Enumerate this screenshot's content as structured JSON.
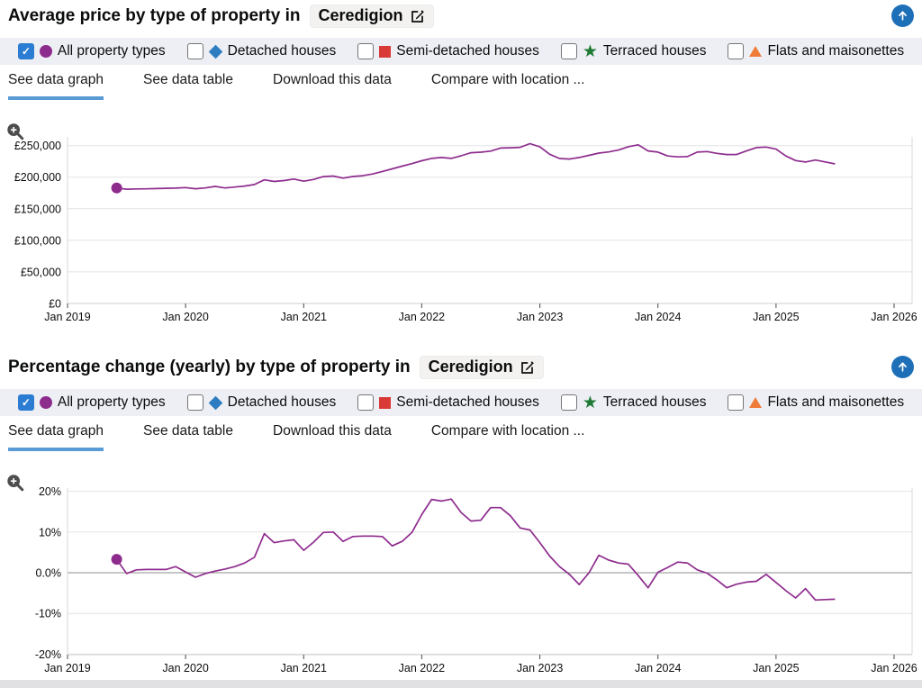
{
  "location": {
    "name": "Ceredigion"
  },
  "colors": {
    "accent_blue": "#1d70b8",
    "checkbox_blue": "#2b7cd3",
    "tab_underline": "#5b9bd5",
    "legend_bar_bg": "#edeff4",
    "location_button_bg": "#f3f2f1",
    "series_purple": "#8e2c8e"
  },
  "icons": {
    "edit": "edit-pencil-square-icon",
    "scroll_top": "up-arrow-circle-icon",
    "zoom": "magnifier-plus-icon"
  },
  "legend": {
    "items": [
      {
        "label": "All property types",
        "checked": true,
        "symbol": "circle",
        "color": "#8e2c8e"
      },
      {
        "label": "Detached houses",
        "checked": false,
        "symbol": "diamond",
        "color": "#2e7dc1"
      },
      {
        "label": "Semi-detached houses",
        "checked": false,
        "symbol": "square",
        "color": "#d93a35"
      },
      {
        "label": "Terraced houses",
        "checked": false,
        "symbol": "star",
        "color": "#1e7a34"
      },
      {
        "label": "Flats and maisonettes",
        "checked": false,
        "symbol": "triangle",
        "color": "#ef7b39"
      }
    ]
  },
  "tabs": [
    {
      "label": "See data graph",
      "active": true
    },
    {
      "label": "See data table",
      "active": false
    },
    {
      "label": "Download this data",
      "active": false
    },
    {
      "label": "Compare with location ...",
      "active": false
    }
  ],
  "sections": [
    {
      "title": "Average price by type of property in",
      "chart_data": {
        "type": "line",
        "title": "Average price by type of property in Ceredigion",
        "xlabel": "",
        "ylabel": "",
        "grid": true,
        "legend_position": "top",
        "x_ticks": [
          "Jan 2019",
          "Jan 2020",
          "Jan 2021",
          "Jan 2022",
          "Jan 2023",
          "Jan 2024",
          "Jan 2025",
          "Jan 2026"
        ],
        "y_ticks": [
          "£0",
          "£50,000",
          "£100,000",
          "£150,000",
          "£200,000",
          "£250,000"
        ],
        "y_tick_values": [
          0,
          50000,
          100000,
          150000,
          200000,
          250000
        ],
        "ylim": [
          0,
          262000
        ],
        "series": [
          {
            "name": "All property types",
            "color": "#8e2c8e",
            "start": "2019-06",
            "freq": "monthly",
            "values": [
              183000,
              181000,
              181300,
              181500,
              182000,
              182400,
              182700,
              183500,
              181600,
              182900,
              185400,
              183000,
              184300,
              186000,
              188400,
              195800,
              193200,
              194700,
              197100,
              193700,
              196400,
              200900,
              201700,
              198500,
              201100,
              202400,
              205000,
              209000,
              213200,
              217500,
              221500,
              226000,
              229700,
              231100,
              229700,
              233900,
              238700,
              239600,
              241200,
              246100,
              246600,
              247300,
              253100,
              247900,
              236200,
              229600,
              228700,
              231200,
              234500,
              238100,
              240000,
              243000,
              248200,
              251300,
              241500,
              239700,
              233500,
              232100,
              232500,
              239700,
              240600,
              237700,
              235800,
              235800,
              241500,
              246800,
              247700,
              244400,
              233500,
              226300,
              224000,
              227100,
              224200,
              221000
            ]
          }
        ]
      }
    },
    {
      "title": "Percentage change (yearly) by type of property in",
      "chart_data": {
        "type": "line",
        "title": "Percentage change (yearly) by type of property in Ceredigion",
        "xlabel": "",
        "ylabel": "",
        "grid": true,
        "legend_position": "top",
        "x_ticks": [
          "Jan 2019",
          "Jan 2020",
          "Jan 2021",
          "Jan 2022",
          "Jan 2023",
          "Jan 2024",
          "Jan 2025",
          "Jan 2026"
        ],
        "y_ticks": [
          "-20%",
          "-10%",
          "0.0%",
          "10%",
          "20%"
        ],
        "y_tick_values": [
          -20,
          -10,
          0,
          10,
          20
        ],
        "ylim": [
          -20,
          20
        ],
        "series": [
          {
            "name": "All property types",
            "color": "#8e2c8e",
            "start": "2019-06",
            "freq": "monthly",
            "values": [
              3.3,
              -0.2,
              0.7,
              0.8,
              0.8,
              0.8,
              1.5,
              0.2,
              -1.1,
              -0.2,
              0.4,
              0.9,
              1.5,
              2.4,
              3.8,
              9.6,
              7.4,
              7.8,
              8.1,
              5.5,
              7.5,
              9.9,
              10.0,
              7.7,
              8.9,
              9.0,
              9.0,
              8.9,
              6.6,
              7.7,
              9.9,
              14.3,
              18.0,
              17.6,
              18.1,
              14.8,
              12.7,
              12.9,
              16.0,
              16.0,
              14.0,
              11.0,
              10.5,
              7.4,
              4.1,
              1.5,
              -0.4,
              -2.9,
              0.0,
              4.3,
              3.1,
              2.4,
              2.1,
              -0.7,
              -3.7,
              0.1,
              1.3,
              2.6,
              2.4,
              0.7,
              -0.1,
              -1.8,
              -3.7,
              -2.8,
              -2.3,
              -2.1,
              -0.4,
              -2.4,
              -4.4,
              -6.2,
              -3.9,
              -6.7,
              -6.6,
              -6.5
            ]
          }
        ]
      }
    }
  ]
}
